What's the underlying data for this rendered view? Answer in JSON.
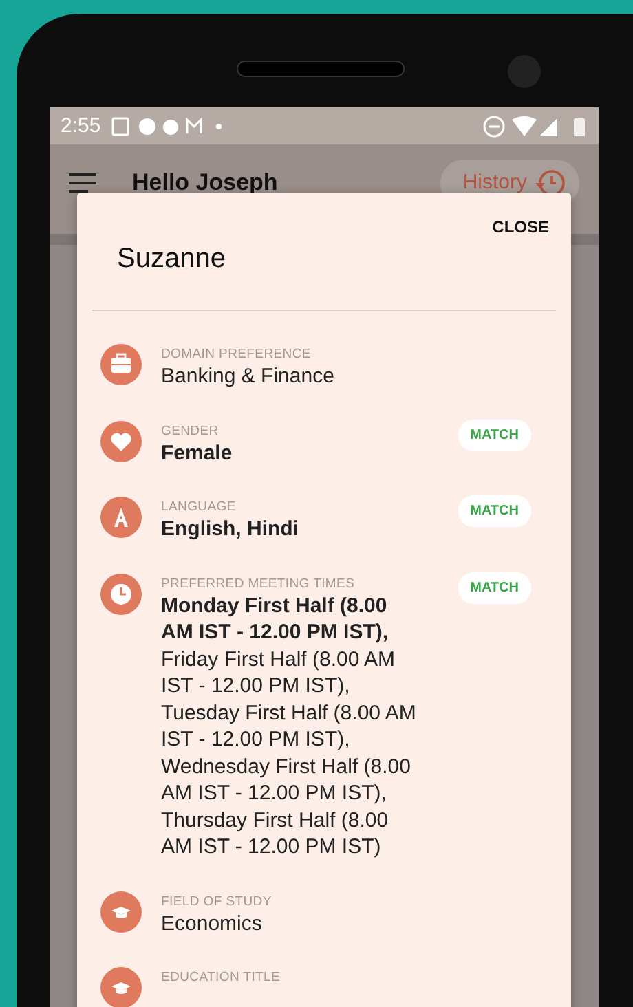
{
  "status_bar": {
    "time": "2:55"
  },
  "app_bar": {
    "greeting": "Hello Joseph",
    "history_button": "History"
  },
  "dialog": {
    "title": "Suzanne",
    "close_button": "CLOSE",
    "items": [
      {
        "kind": "briefcase",
        "label": "DOMAIN PREFERENCE",
        "values": [
          {
            "text": "Banking & Finance",
            "bold": false
          }
        ]
      },
      {
        "kind": "heart",
        "label": "GENDER",
        "match": "MATCH",
        "values": [
          {
            "text": "Female",
            "bold": true
          }
        ]
      },
      {
        "kind": "language",
        "label": "LANGUAGE",
        "match": "MATCH",
        "values": [
          {
            "text": "English, Hindi",
            "bold": true
          }
        ]
      },
      {
        "kind": "clock",
        "label": "PREFERRED MEETING TIMES",
        "match": "MATCH",
        "values": [
          {
            "text": "Monday First Half (8.00 AM IST - 12.00 PM IST),",
            "bold": true
          },
          {
            "text": "Friday First Half (8.00 AM IST - 12.00 PM IST),",
            "bold": false
          },
          {
            "text": "Tuesday First Half (8.00 AM IST - 12.00 PM IST),",
            "bold": false
          },
          {
            "text": "Wednesday First Half (8.00 AM IST - 12.00 PM IST),",
            "bold": false
          },
          {
            "text": "Thursday First Half (8.00 AM IST - 12.00 PM IST)",
            "bold": false
          }
        ]
      },
      {
        "kind": "cap",
        "label": "FIELD OF STUDY",
        "values": [
          {
            "text": "Economics",
            "bold": false
          }
        ]
      },
      {
        "kind": "cap",
        "label": "EDUCATION TITLE"
      }
    ]
  }
}
